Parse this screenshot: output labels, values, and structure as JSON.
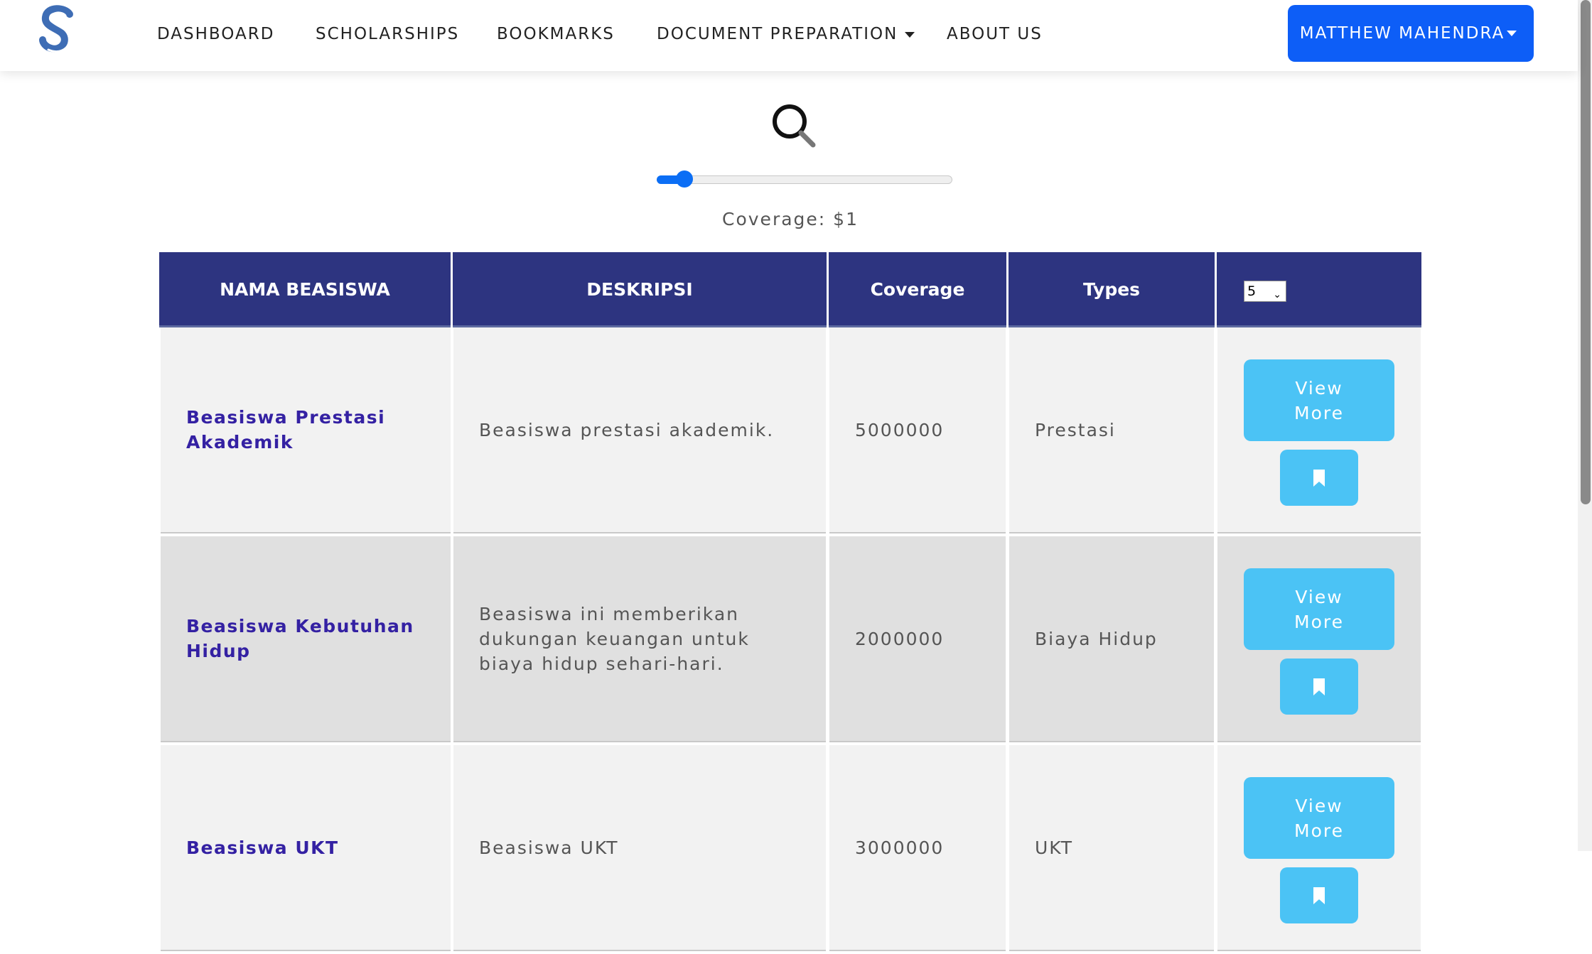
{
  "nav": {
    "items": [
      "DASHBOARD",
      "SCHOLARSHIPS",
      "BOOKMARKS",
      "DOCUMENT PREPARATION",
      "ABOUT US"
    ],
    "user_name": "MATTHEW MAHENDRA"
  },
  "filter": {
    "coverage_label": "Coverage: $1",
    "slider_fraction": 0.07
  },
  "table": {
    "headers": [
      "NAMA BEASISWA",
      "DESKRIPSI",
      "Coverage",
      "Types"
    ],
    "page_size": "5",
    "rows": [
      {
        "name": "Beasiswa Prestasi Akademik",
        "description": "Beasiswa prestasi akademik.",
        "coverage": "5000000",
        "type": "Prestasi",
        "view_label": "View More"
      },
      {
        "name": "Beasiswa Kebutuhan Hidup",
        "description": "Beasiswa ini memberikan dukungan keuangan untuk biaya hidup sehari-hari.",
        "coverage": "2000000",
        "type": "Biaya Hidup",
        "view_label": "View More"
      },
      {
        "name": "Beasiswa UKT",
        "description": "Beasiswa UKT",
        "coverage": "3000000",
        "type": "UKT",
        "view_label": "View More"
      }
    ]
  },
  "colors": {
    "primary": "#0d5ef7",
    "table_header": "#2d3480",
    "action_button": "#4bc3f5",
    "link_name": "#3421a3"
  }
}
